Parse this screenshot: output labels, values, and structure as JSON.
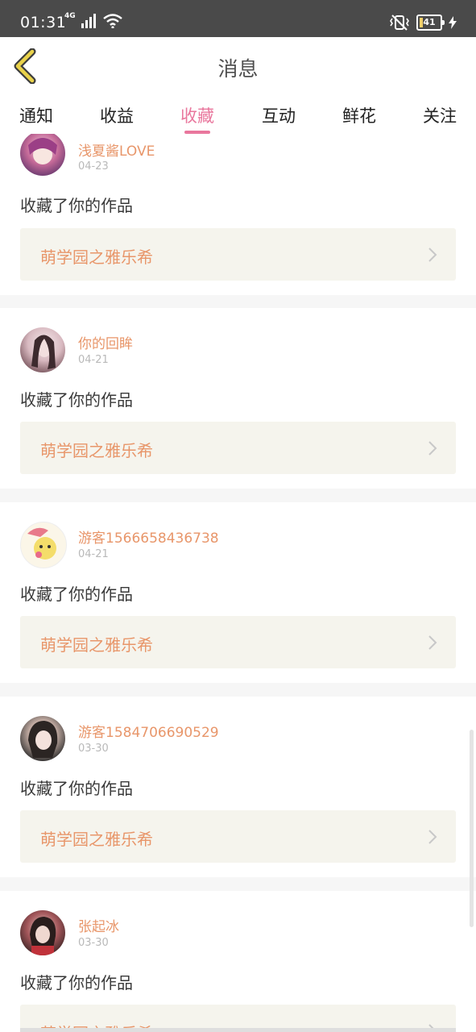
{
  "status_bar": {
    "time": "01:31",
    "network": "4G",
    "battery": "41",
    "icons": [
      "signal-icon",
      "wifi-icon",
      "vibrate-icon",
      "battery-icon",
      "charging-icon"
    ]
  },
  "header": {
    "title": "消息",
    "back_icon": "chevron-left-icon"
  },
  "tabs": [
    {
      "label": "通知",
      "active": false
    },
    {
      "label": "收益",
      "active": false
    },
    {
      "label": "收藏",
      "active": true
    },
    {
      "label": "互动",
      "active": false
    },
    {
      "label": "鲜花",
      "active": false
    },
    {
      "label": "关注",
      "active": false
    }
  ],
  "messages": [
    {
      "user": "浅夏酱LOVE",
      "date": "04-23",
      "action": "收藏了你的作品",
      "work": "萌学园之雅乐希"
    },
    {
      "user": "你的回眸",
      "date": "04-21",
      "action": "收藏了你的作品",
      "work": "萌学园之雅乐希"
    },
    {
      "user": "游客1566658436738",
      "date": "04-21",
      "action": "收藏了你的作品",
      "work": "萌学园之雅乐希"
    },
    {
      "user": "游客1584706690529",
      "date": "03-30",
      "action": "收藏了你的作品",
      "work": "萌学园之雅乐希"
    },
    {
      "user": "张起冰",
      "date": "03-30",
      "action": "收藏了你的作品",
      "work": "萌学园之雅乐希"
    }
  ],
  "colors": {
    "accent": "#e9779d",
    "name": "#e8966a",
    "card_bg": "#f5f4ed",
    "back_icon": "#e9d24a"
  }
}
